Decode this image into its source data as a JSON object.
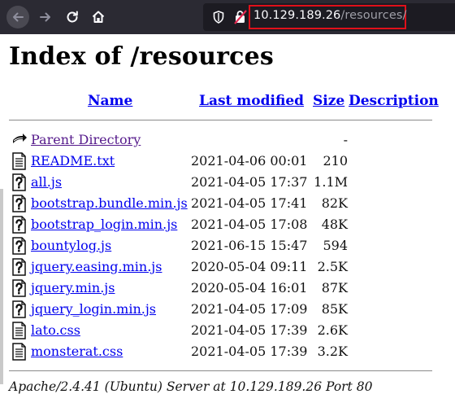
{
  "browser": {
    "url_host": "10.129.189.26",
    "url_path": "/resources/"
  },
  "page": {
    "title": "Index of /resources",
    "columns": {
      "name": "Name",
      "last_modified": "Last modified",
      "size": "Size",
      "description": "Description"
    },
    "parent": {
      "name": "Parent Directory",
      "size": "-"
    },
    "files": [
      {
        "name": "README.txt",
        "modified": "2021-04-06 00:01",
        "size": "210",
        "icon": "text-file-icon"
      },
      {
        "name": "all.js",
        "modified": "2021-04-05 17:37",
        "size": "1.1M",
        "icon": "unknown-file-icon"
      },
      {
        "name": "bootstrap.bundle.min.js",
        "modified": "2021-04-05 17:41",
        "size": "82K",
        "icon": "unknown-file-icon"
      },
      {
        "name": "bootstrap_login.min.js",
        "modified": "2021-04-05 17:08",
        "size": "48K",
        "icon": "unknown-file-icon"
      },
      {
        "name": "bountylog.js",
        "modified": "2021-06-15 15:47",
        "size": "594",
        "icon": "unknown-file-icon"
      },
      {
        "name": "jquery.easing.min.js",
        "modified": "2020-05-04 09:11",
        "size": "2.5K",
        "icon": "unknown-file-icon"
      },
      {
        "name": "jquery.min.js",
        "modified": "2020-05-04 16:01",
        "size": "87K",
        "icon": "unknown-file-icon"
      },
      {
        "name": "jquery_login.min.js",
        "modified": "2021-04-05 17:09",
        "size": "85K",
        "icon": "unknown-file-icon"
      },
      {
        "name": "lato.css",
        "modified": "2021-04-05 17:39",
        "size": "2.6K",
        "icon": "text-file-icon"
      },
      {
        "name": "monsterat.css",
        "modified": "2021-04-05 17:39",
        "size": "3.2K",
        "icon": "text-file-icon"
      }
    ],
    "footer": "Apache/2.4.41 (Ubuntu) Server at 10.129.189.26 Port 80"
  }
}
